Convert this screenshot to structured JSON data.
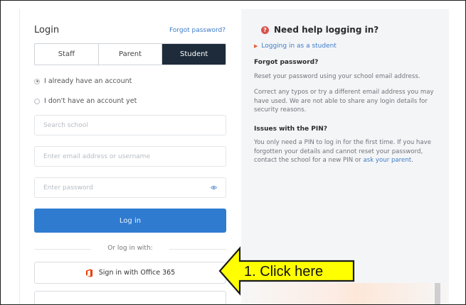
{
  "login": {
    "title": "Login",
    "forgot_link": "Forgot password?",
    "roles": [
      "Staff",
      "Parent",
      "Student"
    ],
    "active_role": "Student",
    "radio_have_account": "I already have an account",
    "radio_no_account": "I don't have an account yet",
    "search_school_placeholder": "Search school",
    "email_placeholder": "Enter email address or username",
    "password_placeholder": "Enter password",
    "login_button": "Log in",
    "or_login_with": "Or log in with:",
    "office_button": "Sign in with Office 365"
  },
  "help": {
    "title": "Need help logging in?",
    "student_link": "Logging in as a student",
    "forgot_heading": "Forgot password?",
    "forgot_p1": "Reset your password using your school email address.",
    "forgot_p2": "Correct any typos or try a different email address you may have used. We are not able to share any login details for security reasons.",
    "pin_heading": "Issues with the PIN?",
    "pin_p_pre": "You only need a PIN to log in for the first time. If you have forgotten your details and cannot reset your password, contact the school for a new PIN or ",
    "pin_link": "ask your parent",
    "pin_p_post": "."
  },
  "callout": {
    "text": "1. Click here"
  },
  "colors": {
    "active_tab": "#1d2b3a",
    "primary_button": "#2f7bd0",
    "link": "#3d7cc9",
    "callout_fill": "#ffff00",
    "office_red": "#eb3c00"
  }
}
